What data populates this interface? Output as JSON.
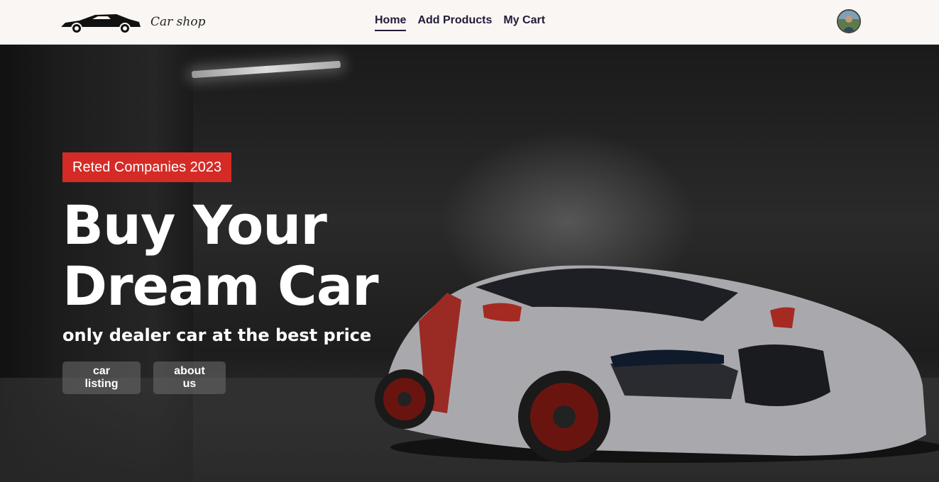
{
  "navbar": {
    "brand_name": "Car shop",
    "links": [
      {
        "label": "Home",
        "active": true
      },
      {
        "label": "Add Products",
        "active": false
      },
      {
        "label": "My Cart",
        "active": false
      }
    ]
  },
  "hero": {
    "badge": "Reted Companies 2023",
    "headline_line1": "Buy Your",
    "headline_line2": "Dream Car",
    "subheadline": "only dealer car at the best price",
    "buttons": {
      "car_listing": "car listing",
      "about_us": "about us"
    }
  },
  "colors": {
    "nav_bg": "#faf6f3",
    "nav_text": "#231a3a",
    "badge_red": "#d52b26",
    "button_bg": "#6e6e6e"
  },
  "icons": {
    "brand_logo": "car-silhouette-icon",
    "avatar": "user-avatar"
  }
}
